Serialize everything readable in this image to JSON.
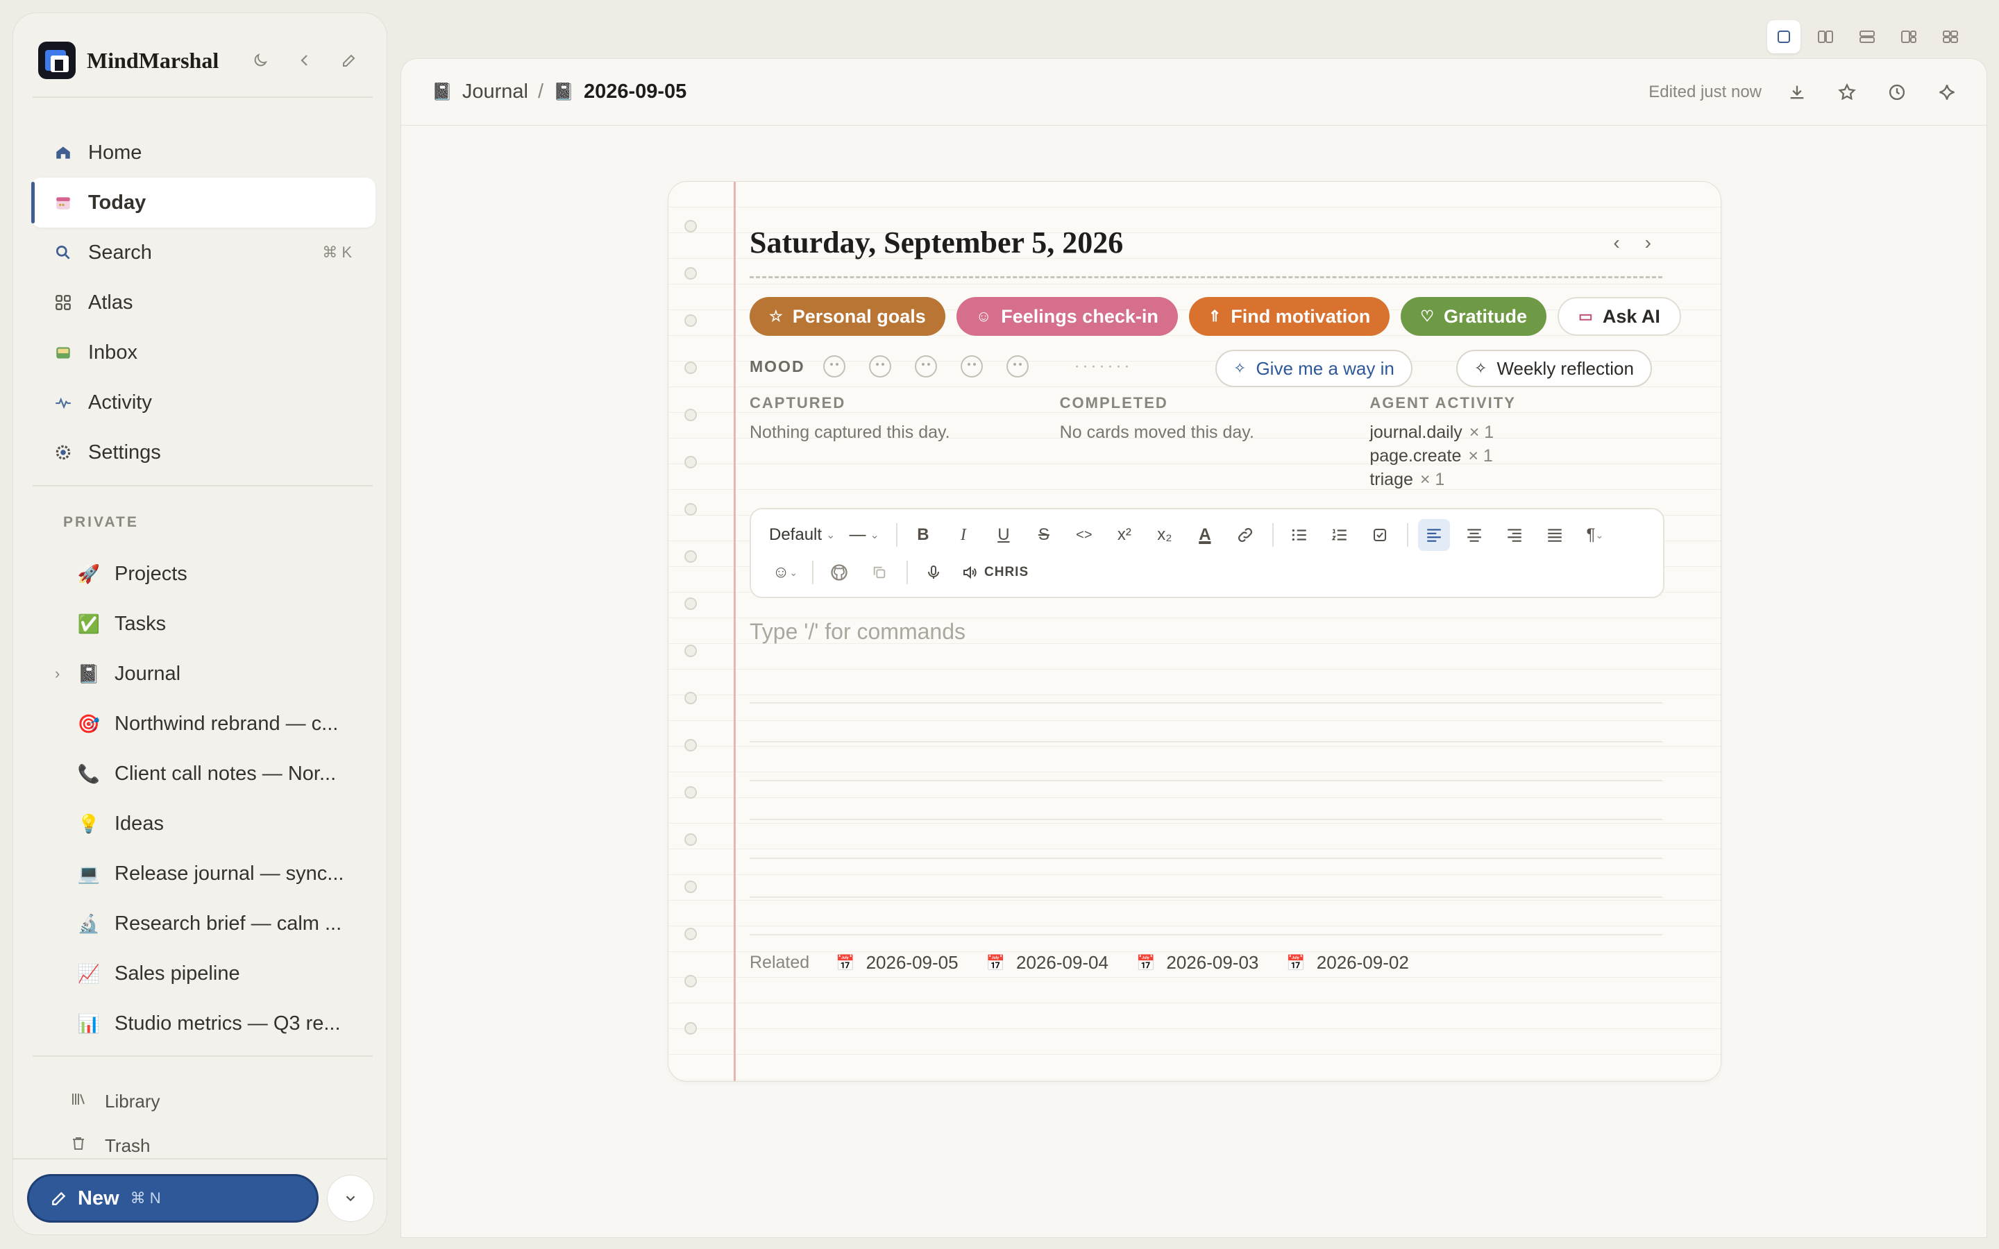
{
  "app": {
    "name": "MindMarshal"
  },
  "sidebar": {
    "nav": [
      {
        "label": "Home",
        "icon": "home-icon"
      },
      {
        "label": "Today",
        "icon": "calendar-icon",
        "active": true
      },
      {
        "label": "Search",
        "icon": "search-icon",
        "shortcut": "⌘ K"
      },
      {
        "label": "Atlas",
        "icon": "grid-icon"
      },
      {
        "label": "Inbox",
        "icon": "inbox-icon"
      },
      {
        "label": "Activity",
        "icon": "activity-icon"
      },
      {
        "label": "Settings",
        "icon": "gear-icon"
      }
    ],
    "section_label": "PRIVATE",
    "pages": [
      {
        "emoji": "🚀",
        "label": "Projects"
      },
      {
        "emoji": "✅",
        "label": "Tasks"
      },
      {
        "emoji": "📓",
        "label": "Journal",
        "expandable": true
      },
      {
        "emoji": "🎯",
        "label": "Northwind rebrand — c..."
      },
      {
        "emoji": "📞",
        "label": "Client call notes — Nor..."
      },
      {
        "emoji": "💡",
        "label": "Ideas"
      },
      {
        "emoji": "💻",
        "label": "Release journal — sync..."
      },
      {
        "emoji": "🔬",
        "label": "Research brief — calm ..."
      },
      {
        "emoji": "📈",
        "label": "Sales pipeline"
      },
      {
        "emoji": "📊",
        "label": "Studio metrics — Q3 re..."
      }
    ],
    "footer": {
      "library": "Library",
      "trash": "Trash"
    },
    "new_button": {
      "label": "New",
      "shortcut": "⌘ N"
    }
  },
  "topbar": {
    "breadcrumb": {
      "parent": "Journal",
      "current": "2026-09-05"
    },
    "edited": "Edited just now"
  },
  "entry": {
    "title": "Saturday, September 5, 2026",
    "chips": [
      {
        "label": "Personal goals",
        "icon": "star-icon",
        "color": "#b87534"
      },
      {
        "label": "Feelings check-in",
        "icon": "smile-icon",
        "color": "#d56f8c"
      },
      {
        "label": "Find motivation",
        "icon": "rocket-icon",
        "color": "#d9712f"
      },
      {
        "label": "Gratitude",
        "icon": "bulb-icon",
        "color": "#6e9a45"
      }
    ],
    "ask_ai": "Ask AI",
    "mood_label": "MOOD",
    "mood_dots": "·······",
    "give_way": "Give me a way in",
    "weekly": "Weekly reflection",
    "captured": {
      "heading": "CAPTURED",
      "text": "Nothing captured this day."
    },
    "completed": {
      "heading": "COMPLETED",
      "text": "No cards moved this day."
    },
    "agent": {
      "heading": "AGENT ACTIVITY",
      "rows": [
        {
          "name": "journal.daily",
          "count": "× 1"
        },
        {
          "name": "page.create",
          "count": "× 1"
        },
        {
          "name": "triage",
          "count": "× 1"
        }
      ]
    },
    "toolbar": {
      "style": "Default",
      "heading": "—",
      "voice": "CHRIS"
    },
    "placeholder": "Type '/' for commands",
    "related_label": "Related",
    "related": [
      "2026-09-05",
      "2026-09-04",
      "2026-09-03",
      "2026-09-02"
    ]
  },
  "colors": {
    "accent": "#2f5899",
    "margin_line": "#e7b6b2"
  }
}
